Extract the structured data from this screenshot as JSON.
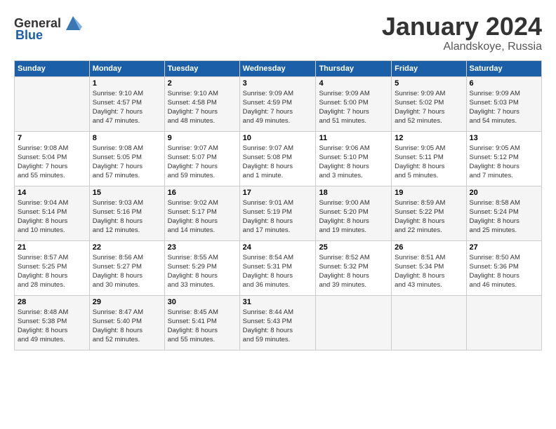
{
  "header": {
    "logo_general": "General",
    "logo_blue": "Blue",
    "month_title": "January 2024",
    "location": "Alandskoye, Russia"
  },
  "days_of_week": [
    "Sunday",
    "Monday",
    "Tuesday",
    "Wednesday",
    "Thursday",
    "Friday",
    "Saturday"
  ],
  "weeks": [
    [
      {
        "day": "",
        "info": ""
      },
      {
        "day": "1",
        "info": "Sunrise: 9:10 AM\nSunset: 4:57 PM\nDaylight: 7 hours\nand 47 minutes."
      },
      {
        "day": "2",
        "info": "Sunrise: 9:10 AM\nSunset: 4:58 PM\nDaylight: 7 hours\nand 48 minutes."
      },
      {
        "day": "3",
        "info": "Sunrise: 9:09 AM\nSunset: 4:59 PM\nDaylight: 7 hours\nand 49 minutes."
      },
      {
        "day": "4",
        "info": "Sunrise: 9:09 AM\nSunset: 5:00 PM\nDaylight: 7 hours\nand 51 minutes."
      },
      {
        "day": "5",
        "info": "Sunrise: 9:09 AM\nSunset: 5:02 PM\nDaylight: 7 hours\nand 52 minutes."
      },
      {
        "day": "6",
        "info": "Sunrise: 9:09 AM\nSunset: 5:03 PM\nDaylight: 7 hours\nand 54 minutes."
      }
    ],
    [
      {
        "day": "7",
        "info": "Sunrise: 9:08 AM\nSunset: 5:04 PM\nDaylight: 7 hours\nand 55 minutes."
      },
      {
        "day": "8",
        "info": "Sunrise: 9:08 AM\nSunset: 5:05 PM\nDaylight: 7 hours\nand 57 minutes."
      },
      {
        "day": "9",
        "info": "Sunrise: 9:07 AM\nSunset: 5:07 PM\nDaylight: 7 hours\nand 59 minutes."
      },
      {
        "day": "10",
        "info": "Sunrise: 9:07 AM\nSunset: 5:08 PM\nDaylight: 8 hours\nand 1 minute."
      },
      {
        "day": "11",
        "info": "Sunrise: 9:06 AM\nSunset: 5:10 PM\nDaylight: 8 hours\nand 3 minutes."
      },
      {
        "day": "12",
        "info": "Sunrise: 9:05 AM\nSunset: 5:11 PM\nDaylight: 8 hours\nand 5 minutes."
      },
      {
        "day": "13",
        "info": "Sunrise: 9:05 AM\nSunset: 5:12 PM\nDaylight: 8 hours\nand 7 minutes."
      }
    ],
    [
      {
        "day": "14",
        "info": "Sunrise: 9:04 AM\nSunset: 5:14 PM\nDaylight: 8 hours\nand 10 minutes."
      },
      {
        "day": "15",
        "info": "Sunrise: 9:03 AM\nSunset: 5:16 PM\nDaylight: 8 hours\nand 12 minutes."
      },
      {
        "day": "16",
        "info": "Sunrise: 9:02 AM\nSunset: 5:17 PM\nDaylight: 8 hours\nand 14 minutes."
      },
      {
        "day": "17",
        "info": "Sunrise: 9:01 AM\nSunset: 5:19 PM\nDaylight: 8 hours\nand 17 minutes."
      },
      {
        "day": "18",
        "info": "Sunrise: 9:00 AM\nSunset: 5:20 PM\nDaylight: 8 hours\nand 19 minutes."
      },
      {
        "day": "19",
        "info": "Sunrise: 8:59 AM\nSunset: 5:22 PM\nDaylight: 8 hours\nand 22 minutes."
      },
      {
        "day": "20",
        "info": "Sunrise: 8:58 AM\nSunset: 5:24 PM\nDaylight: 8 hours\nand 25 minutes."
      }
    ],
    [
      {
        "day": "21",
        "info": "Sunrise: 8:57 AM\nSunset: 5:25 PM\nDaylight: 8 hours\nand 28 minutes."
      },
      {
        "day": "22",
        "info": "Sunrise: 8:56 AM\nSunset: 5:27 PM\nDaylight: 8 hours\nand 30 minutes."
      },
      {
        "day": "23",
        "info": "Sunrise: 8:55 AM\nSunset: 5:29 PM\nDaylight: 8 hours\nand 33 minutes."
      },
      {
        "day": "24",
        "info": "Sunrise: 8:54 AM\nSunset: 5:31 PM\nDaylight: 8 hours\nand 36 minutes."
      },
      {
        "day": "25",
        "info": "Sunrise: 8:52 AM\nSunset: 5:32 PM\nDaylight: 8 hours\nand 39 minutes."
      },
      {
        "day": "26",
        "info": "Sunrise: 8:51 AM\nSunset: 5:34 PM\nDaylight: 8 hours\nand 43 minutes."
      },
      {
        "day": "27",
        "info": "Sunrise: 8:50 AM\nSunset: 5:36 PM\nDaylight: 8 hours\nand 46 minutes."
      }
    ],
    [
      {
        "day": "28",
        "info": "Sunrise: 8:48 AM\nSunset: 5:38 PM\nDaylight: 8 hours\nand 49 minutes."
      },
      {
        "day": "29",
        "info": "Sunrise: 8:47 AM\nSunset: 5:40 PM\nDaylight: 8 hours\nand 52 minutes."
      },
      {
        "day": "30",
        "info": "Sunrise: 8:45 AM\nSunset: 5:41 PM\nDaylight: 8 hours\nand 55 minutes."
      },
      {
        "day": "31",
        "info": "Sunrise: 8:44 AM\nSunset: 5:43 PM\nDaylight: 8 hours\nand 59 minutes."
      },
      {
        "day": "",
        "info": ""
      },
      {
        "day": "",
        "info": ""
      },
      {
        "day": "",
        "info": ""
      }
    ]
  ]
}
